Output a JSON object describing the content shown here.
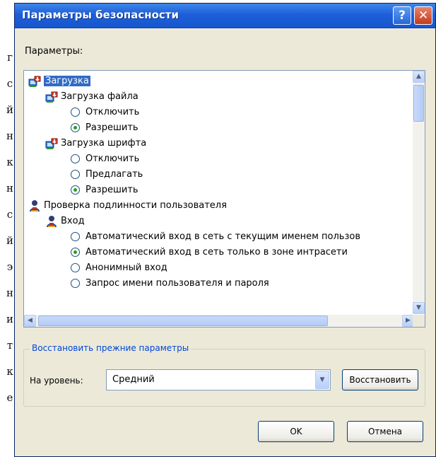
{
  "background_letters": [
    "г",
    "с",
    "й",
    "н",
    "к",
    "н",
    "с",
    "й",
    "э",
    "н",
    "и",
    "т",
    "к",
    "е"
  ],
  "window": {
    "title": "Параметры безопасности",
    "help_glyph": "?",
    "close_glyph": "✕"
  },
  "settings_label": "Параметры:",
  "tree": [
    {
      "label": "Загрузка",
      "level": 0,
      "icon": "download-settings-icon",
      "selected": true
    },
    {
      "label": "Загрузка файла",
      "level": 1,
      "icon": "download-settings-icon"
    },
    {
      "label": "Отключить",
      "level": 2,
      "radio": false
    },
    {
      "label": "Разрешить",
      "level": 2,
      "radio": true
    },
    {
      "label": "Загрузка шрифта",
      "level": 1,
      "icon": "download-settings-icon"
    },
    {
      "label": "Отключить",
      "level": 2,
      "radio": false
    },
    {
      "label": "Предлагать",
      "level": 2,
      "radio": false
    },
    {
      "label": "Разрешить",
      "level": 2,
      "radio": true
    },
    {
      "label": "Проверка подлинности пользователя",
      "level": 0,
      "icon": "user-auth-icon"
    },
    {
      "label": "Вход",
      "level": 1,
      "icon": "user-auth-icon"
    },
    {
      "label": "Автоматический вход в сеть с текущим именем пользов",
      "level": 2,
      "radio": false
    },
    {
      "label": "Автоматический вход в сеть только в зоне интрасети",
      "level": 2,
      "radio": true
    },
    {
      "label": "Анонимный вход",
      "level": 2,
      "radio": false
    },
    {
      "label": "Запрос имени пользователя и пароля",
      "level": 2,
      "radio": false
    }
  ],
  "reset_group": {
    "title": "Восстановить прежние параметры",
    "level_label": "На уровень:",
    "level_value": "Средний",
    "reset_button": "Восстановить"
  },
  "buttons": {
    "ok": "OK",
    "cancel": "Отмена"
  },
  "colors": {
    "title_bar": "#1e5fd9",
    "selection": "#316ac5",
    "group_title": "#0046d5"
  }
}
